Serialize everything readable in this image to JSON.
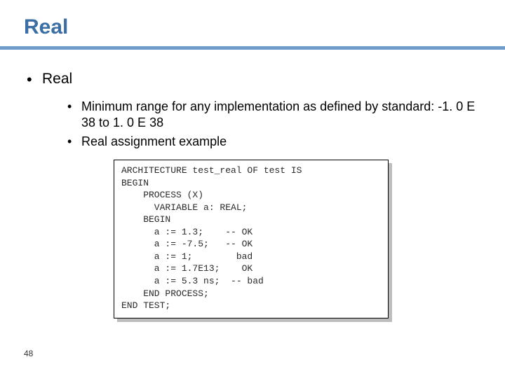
{
  "title": "Real",
  "bullets": {
    "lvl1": "Real",
    "lvl2a": "Minimum range for any implementation as defined by standard:  -1. 0 E 38 to 1. 0 E 38",
    "lvl2b": "Real assignment example"
  },
  "code": "ARCHITECTURE test_real OF test IS\nBEGIN\n    PROCESS (X)\n      VARIABLE a: REAL;\n    BEGIN\n      a := 1.3;    -- OK\n      a := -7.5;   -- OK\n      a := 1;        bad\n      a := 1.7E13;    OK\n      a := 5.3 ns;  -- bad\n    END PROCESS;\nEND TEST;",
  "page_number": "48"
}
